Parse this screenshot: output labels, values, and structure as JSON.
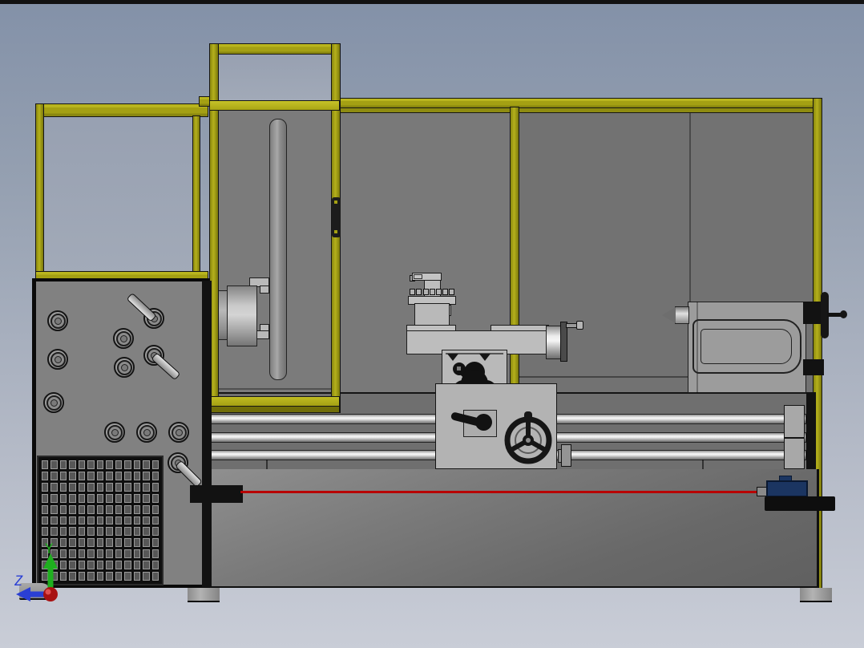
{
  "viewport": {
    "description": "Shaded 3D CAD view of a lathe machine with control cabinet inside a yellow-framed safety enclosure",
    "triad": {
      "y_label": "Y",
      "z_label": "Z"
    },
    "colors": {
      "frame_yellow": "#a4a013",
      "enclosure_panel_gray": "#797979",
      "machine_base_gray": "#6b6b6b",
      "laser_line_red": "#b80000",
      "laser_device_blue": "#1b3561",
      "triad_y_green": "#1faf1f",
      "triad_z_blue": "#2a3fd4",
      "triad_origin_red": "#c41c1c",
      "sky_top": "#8391a8",
      "sky_bottom": "#c9cdd7"
    }
  }
}
